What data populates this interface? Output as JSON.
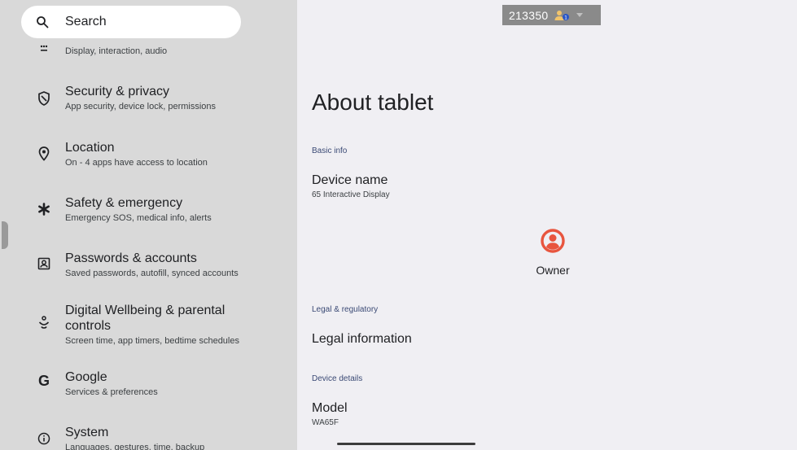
{
  "search": {
    "label": "Search"
  },
  "sidebar": {
    "items": [
      {
        "title": "",
        "subtitle": "Display, interaction, audio",
        "icon": "dots-icon"
      },
      {
        "title": "Security & privacy",
        "subtitle": "App security, device lock, permissions",
        "icon": "shield-icon"
      },
      {
        "title": "Location",
        "subtitle": "On - 4 apps have access to location",
        "icon": "location-pin-icon"
      },
      {
        "title": "Safety & emergency",
        "subtitle": "Emergency SOS, medical info, alerts",
        "icon": "asterisk-icon"
      },
      {
        "title": "Passwords & accounts",
        "subtitle": "Saved passwords, autofill, synced accounts",
        "icon": "account-box-icon"
      },
      {
        "title": "Digital Wellbeing & parental controls",
        "subtitle": "Screen time, app timers, bedtime schedules",
        "icon": "wellbeing-icon"
      },
      {
        "title": "Google",
        "subtitle": "Services & preferences",
        "icon": "google-g-icon"
      },
      {
        "title": "System",
        "subtitle": "Languages, gestures, time, backup",
        "icon": "info-icon"
      }
    ]
  },
  "topbar": {
    "count": "213350"
  },
  "main": {
    "title": "About tablet",
    "basic_info_header": "Basic info",
    "device_name_title": "Device name",
    "device_name_value": "65 Interactive Display",
    "owner_label": "Owner",
    "legal_header": "Legal & regulatory",
    "legal_info_title": "Legal information",
    "device_details_header": "Device details",
    "model_title": "Model",
    "model_value": "WA65F"
  },
  "colors": {
    "owner_icon": "#e8553e",
    "section_header": "#3b4a75",
    "sidebar_bg": "#d9d9d9",
    "main_bg": "#f0eff3"
  }
}
